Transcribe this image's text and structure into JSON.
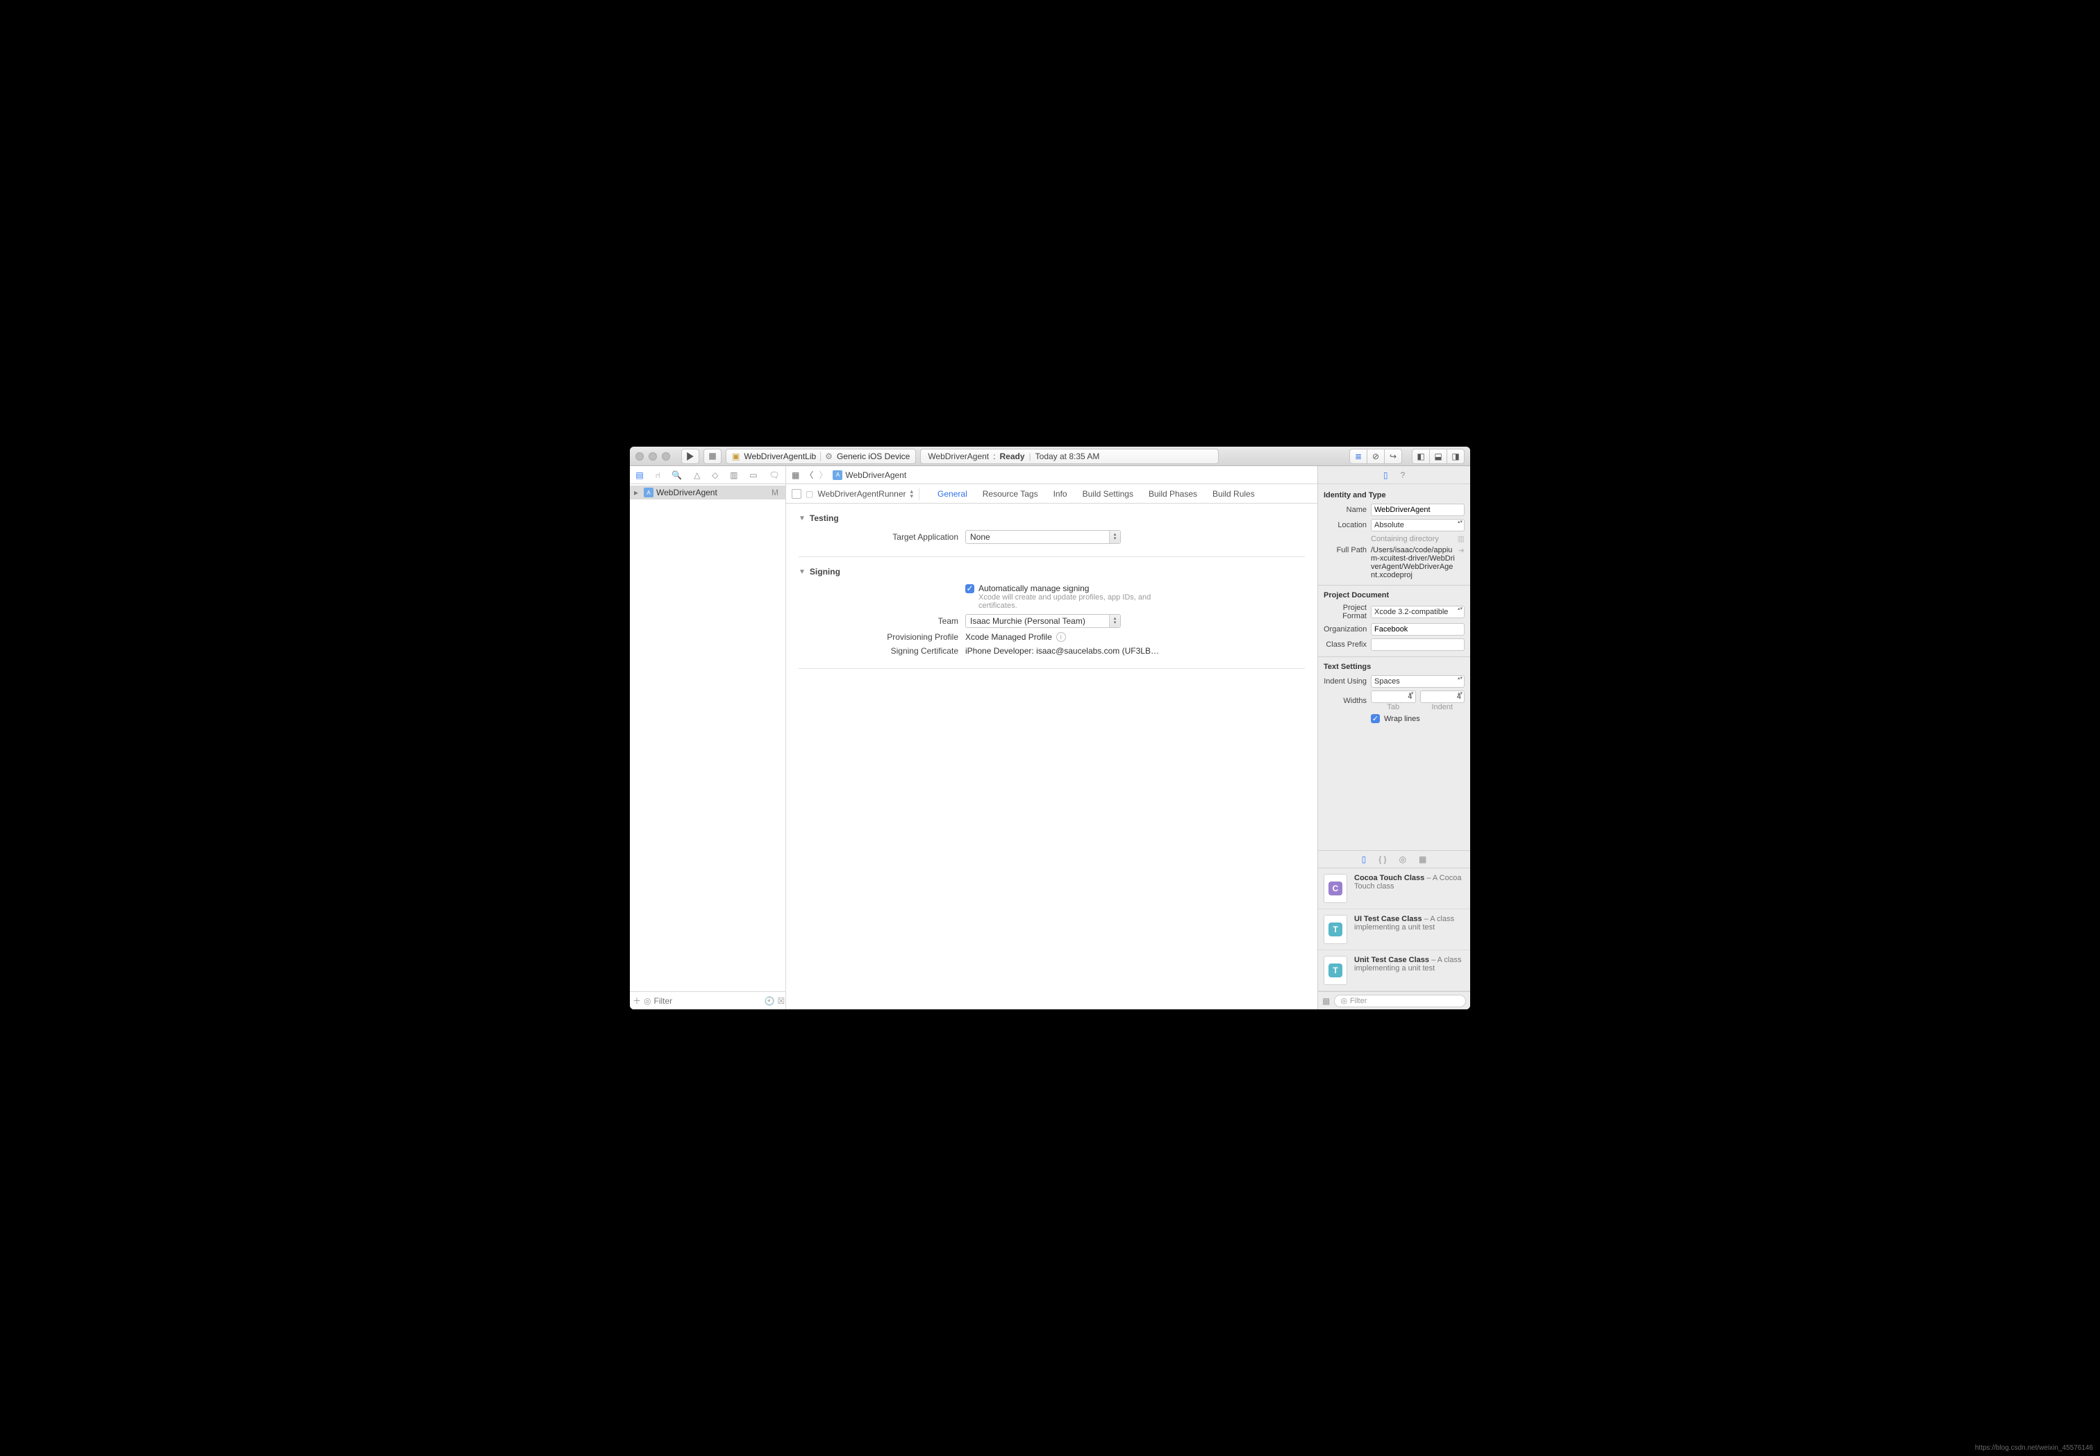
{
  "toolbar": {
    "scheme_target": "WebDriverAgentLib",
    "scheme_device": "Generic iOS Device",
    "activity_project": "WebDriverAgent",
    "activity_status": "Ready",
    "activity_time": "Today at 8:35 AM"
  },
  "navigator": {
    "project_name": "WebDriverAgent",
    "project_badge": "M",
    "filter_placeholder": "Filter"
  },
  "jumpbar": {
    "crumb": "WebDriverAgent"
  },
  "target_selector": "WebDriverAgentRunner",
  "tabs": [
    "General",
    "Resource Tags",
    "Info",
    "Build Settings",
    "Build Phases",
    "Build Rules"
  ],
  "sections": {
    "testing": {
      "title": "Testing",
      "target_app_label": "Target Application",
      "target_app_value": "None"
    },
    "signing": {
      "title": "Signing",
      "auto_label": "Automatically manage signing",
      "auto_hint": "Xcode will create and update profiles, app IDs, and certificates.",
      "team_label": "Team",
      "team_value": "Isaac Murchie (Personal Team)",
      "profile_label": "Provisioning Profile",
      "profile_value": "Xcode Managed Profile",
      "cert_label": "Signing Certificate",
      "cert_value": "iPhone Developer: isaac@saucelabs.com (UF3LB…"
    }
  },
  "inspector": {
    "identity_h": "Identity and Type",
    "name_label": "Name",
    "name_value": "WebDriverAgent",
    "location_label": "Location",
    "location_value": "Absolute",
    "containing_label": "Containing directory",
    "fullpath_label": "Full Path",
    "fullpath_value": "/Users/isaac/code/appium-xcuitest-driver/WebDriverAgent/WebDriverAgent.xcodeproj",
    "projdoc_h": "Project Document",
    "format_label": "Project Format",
    "format_value": "Xcode 3.2-compatible",
    "org_label": "Organization",
    "org_value": "Facebook",
    "prefix_label": "Class Prefix",
    "prefix_value": "",
    "text_h": "Text Settings",
    "indent_label": "Indent Using",
    "indent_value": "Spaces",
    "widths_label": "Widths",
    "tab_value": "4",
    "indent_width_value": "4",
    "tab_caption": "Tab",
    "indent_caption": "Indent",
    "wrap_label": "Wrap lines"
  },
  "library": {
    "items": [
      {
        "badge": "C",
        "color": "#9a7fcf",
        "title": "Cocoa Touch Class",
        "desc": "A Cocoa Touch class"
      },
      {
        "badge": "T",
        "color": "#57b7c9",
        "title": "UI Test Case Class",
        "desc": "A class implementing a unit test"
      },
      {
        "badge": "T",
        "color": "#57b7c9",
        "title": "Unit Test Case Class",
        "desc": "A class implementing a unit test"
      }
    ],
    "filter_placeholder": "Filter"
  },
  "watermark": "https://blog.csdn.net/weixin_45576146"
}
